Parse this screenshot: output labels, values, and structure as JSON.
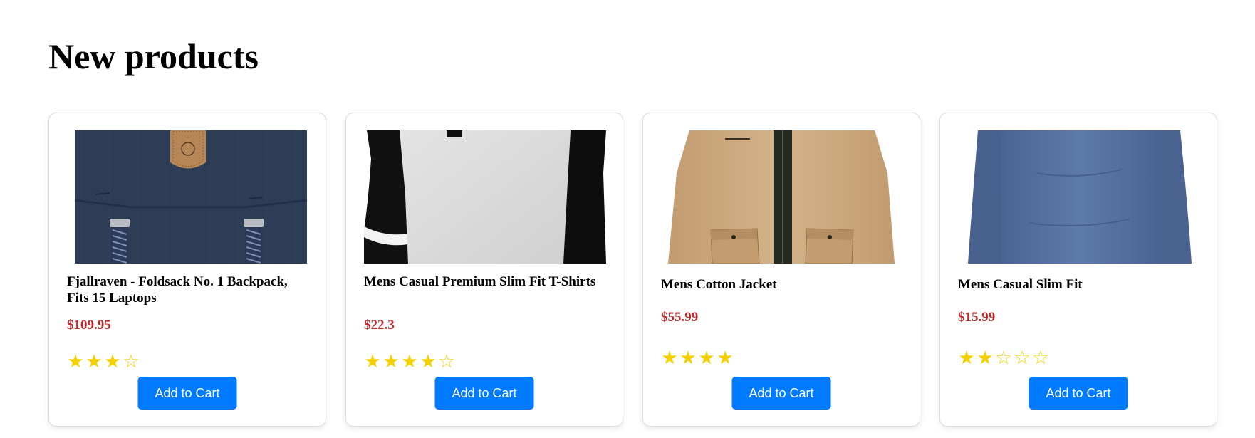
{
  "section": {
    "title": "New products"
  },
  "colors": {
    "price": "#c0292b",
    "star": "#f5d000",
    "button": "#007bff",
    "button_text": "#ffffff"
  },
  "products": [
    {
      "name": "Fjallraven - Foldsack No. 1 Backpack, Fits 15 Laptops",
      "price": "$109.95",
      "rating": 3,
      "rating_max": 4,
      "stars": "★★★☆",
      "button_label": "Add to Cart",
      "image_icon": "backpack-image"
    },
    {
      "name": "Mens Casual Premium Slim Fit T-Shirts",
      "price": "$22.3",
      "rating": 4,
      "rating_max": 5,
      "stars": "★★★★☆",
      "button_label": "Add to Cart",
      "image_icon": "raglan-tshirt-image"
    },
    {
      "name": "Mens Cotton Jacket",
      "price": "$55.99",
      "rating": 4,
      "rating_max": 4,
      "stars": "★★★★",
      "button_label": "Add to Cart",
      "image_icon": "cotton-jacket-image"
    },
    {
      "name": "Mens Casual Slim Fit",
      "price": "$15.99",
      "rating": 2,
      "rating_max": 5,
      "stars": "★★☆☆☆",
      "button_label": "Add to Cart",
      "image_icon": "long-sleeve-shirt-image"
    }
  ]
}
